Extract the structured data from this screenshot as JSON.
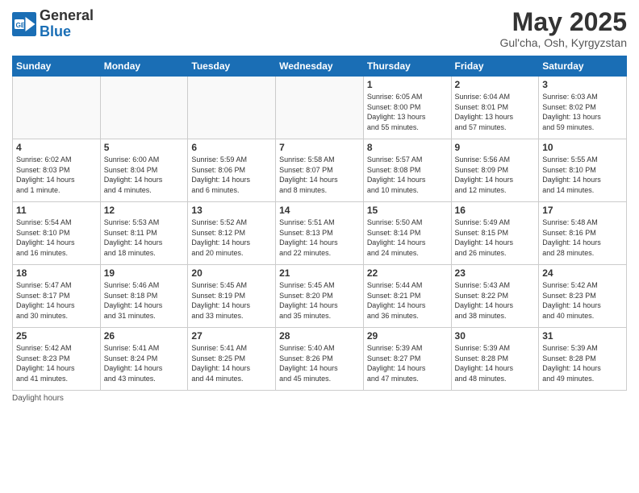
{
  "header": {
    "logo_general": "General",
    "logo_blue": "Blue",
    "month_title": "May 2025",
    "location": "Gul'cha, Osh, Kyrgyzstan"
  },
  "days_of_week": [
    "Sunday",
    "Monday",
    "Tuesday",
    "Wednesday",
    "Thursday",
    "Friday",
    "Saturday"
  ],
  "weeks": [
    [
      {
        "num": "",
        "info": ""
      },
      {
        "num": "",
        "info": ""
      },
      {
        "num": "",
        "info": ""
      },
      {
        "num": "",
        "info": ""
      },
      {
        "num": "1",
        "info": "Sunrise: 6:05 AM\nSunset: 8:00 PM\nDaylight: 13 hours\nand 55 minutes."
      },
      {
        "num": "2",
        "info": "Sunrise: 6:04 AM\nSunset: 8:01 PM\nDaylight: 13 hours\nand 57 minutes."
      },
      {
        "num": "3",
        "info": "Sunrise: 6:03 AM\nSunset: 8:02 PM\nDaylight: 13 hours\nand 59 minutes."
      }
    ],
    [
      {
        "num": "4",
        "info": "Sunrise: 6:02 AM\nSunset: 8:03 PM\nDaylight: 14 hours\nand 1 minute."
      },
      {
        "num": "5",
        "info": "Sunrise: 6:00 AM\nSunset: 8:04 PM\nDaylight: 14 hours\nand 4 minutes."
      },
      {
        "num": "6",
        "info": "Sunrise: 5:59 AM\nSunset: 8:06 PM\nDaylight: 14 hours\nand 6 minutes."
      },
      {
        "num": "7",
        "info": "Sunrise: 5:58 AM\nSunset: 8:07 PM\nDaylight: 14 hours\nand 8 minutes."
      },
      {
        "num": "8",
        "info": "Sunrise: 5:57 AM\nSunset: 8:08 PM\nDaylight: 14 hours\nand 10 minutes."
      },
      {
        "num": "9",
        "info": "Sunrise: 5:56 AM\nSunset: 8:09 PM\nDaylight: 14 hours\nand 12 minutes."
      },
      {
        "num": "10",
        "info": "Sunrise: 5:55 AM\nSunset: 8:10 PM\nDaylight: 14 hours\nand 14 minutes."
      }
    ],
    [
      {
        "num": "11",
        "info": "Sunrise: 5:54 AM\nSunset: 8:10 PM\nDaylight: 14 hours\nand 16 minutes."
      },
      {
        "num": "12",
        "info": "Sunrise: 5:53 AM\nSunset: 8:11 PM\nDaylight: 14 hours\nand 18 minutes."
      },
      {
        "num": "13",
        "info": "Sunrise: 5:52 AM\nSunset: 8:12 PM\nDaylight: 14 hours\nand 20 minutes."
      },
      {
        "num": "14",
        "info": "Sunrise: 5:51 AM\nSunset: 8:13 PM\nDaylight: 14 hours\nand 22 minutes."
      },
      {
        "num": "15",
        "info": "Sunrise: 5:50 AM\nSunset: 8:14 PM\nDaylight: 14 hours\nand 24 minutes."
      },
      {
        "num": "16",
        "info": "Sunrise: 5:49 AM\nSunset: 8:15 PM\nDaylight: 14 hours\nand 26 minutes."
      },
      {
        "num": "17",
        "info": "Sunrise: 5:48 AM\nSunset: 8:16 PM\nDaylight: 14 hours\nand 28 minutes."
      }
    ],
    [
      {
        "num": "18",
        "info": "Sunrise: 5:47 AM\nSunset: 8:17 PM\nDaylight: 14 hours\nand 30 minutes."
      },
      {
        "num": "19",
        "info": "Sunrise: 5:46 AM\nSunset: 8:18 PM\nDaylight: 14 hours\nand 31 minutes."
      },
      {
        "num": "20",
        "info": "Sunrise: 5:45 AM\nSunset: 8:19 PM\nDaylight: 14 hours\nand 33 minutes."
      },
      {
        "num": "21",
        "info": "Sunrise: 5:45 AM\nSunset: 8:20 PM\nDaylight: 14 hours\nand 35 minutes."
      },
      {
        "num": "22",
        "info": "Sunrise: 5:44 AM\nSunset: 8:21 PM\nDaylight: 14 hours\nand 36 minutes."
      },
      {
        "num": "23",
        "info": "Sunrise: 5:43 AM\nSunset: 8:22 PM\nDaylight: 14 hours\nand 38 minutes."
      },
      {
        "num": "24",
        "info": "Sunrise: 5:42 AM\nSunset: 8:23 PM\nDaylight: 14 hours\nand 40 minutes."
      }
    ],
    [
      {
        "num": "25",
        "info": "Sunrise: 5:42 AM\nSunset: 8:23 PM\nDaylight: 14 hours\nand 41 minutes."
      },
      {
        "num": "26",
        "info": "Sunrise: 5:41 AM\nSunset: 8:24 PM\nDaylight: 14 hours\nand 43 minutes."
      },
      {
        "num": "27",
        "info": "Sunrise: 5:41 AM\nSunset: 8:25 PM\nDaylight: 14 hours\nand 44 minutes."
      },
      {
        "num": "28",
        "info": "Sunrise: 5:40 AM\nSunset: 8:26 PM\nDaylight: 14 hours\nand 45 minutes."
      },
      {
        "num": "29",
        "info": "Sunrise: 5:39 AM\nSunset: 8:27 PM\nDaylight: 14 hours\nand 47 minutes."
      },
      {
        "num": "30",
        "info": "Sunrise: 5:39 AM\nSunset: 8:28 PM\nDaylight: 14 hours\nand 48 minutes."
      },
      {
        "num": "31",
        "info": "Sunrise: 5:39 AM\nSunset: 8:28 PM\nDaylight: 14 hours\nand 49 minutes."
      }
    ]
  ],
  "footer": {
    "note": "Daylight hours"
  }
}
